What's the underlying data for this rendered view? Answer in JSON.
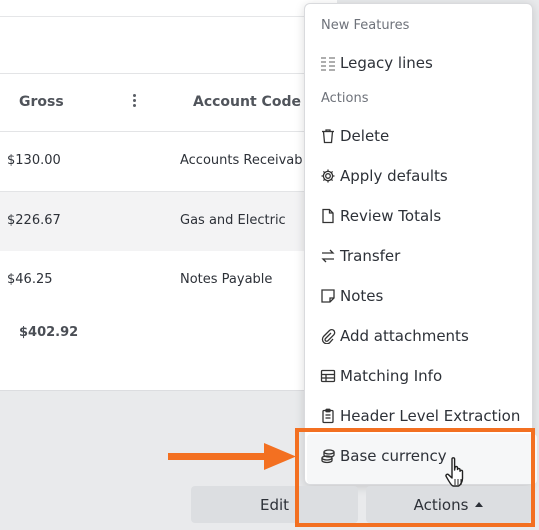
{
  "table": {
    "headers": {
      "gross": "Gross",
      "account_code": "Account Code"
    },
    "rows": [
      {
        "gross": "$130.00",
        "account_code": "Accounts Receivab"
      },
      {
        "gross": "$226.67",
        "account_code": "Gas and Electric"
      },
      {
        "gross": "$46.25",
        "account_code": "Notes Payable"
      }
    ],
    "total": "$402.92"
  },
  "menu": {
    "section_new": "New Features",
    "legacy_lines": "Legacy lines",
    "section_actions": "Actions",
    "items": {
      "delete": "Delete",
      "apply_defaults": "Apply defaults",
      "review_totals": "Review Totals",
      "transfer": "Transfer",
      "notes": "Notes",
      "add_attachments": "Add attachments",
      "matching_info": "Matching Info",
      "header_extraction": "Header Level Extraction",
      "base_currency": "Base currency"
    }
  },
  "footer": {
    "edit_label": "Edit",
    "actions_label": "Actions"
  },
  "colors": {
    "annotation": "#f37021",
    "button_bg": "#dcdee1",
    "menu_bg": "#ffffff"
  }
}
